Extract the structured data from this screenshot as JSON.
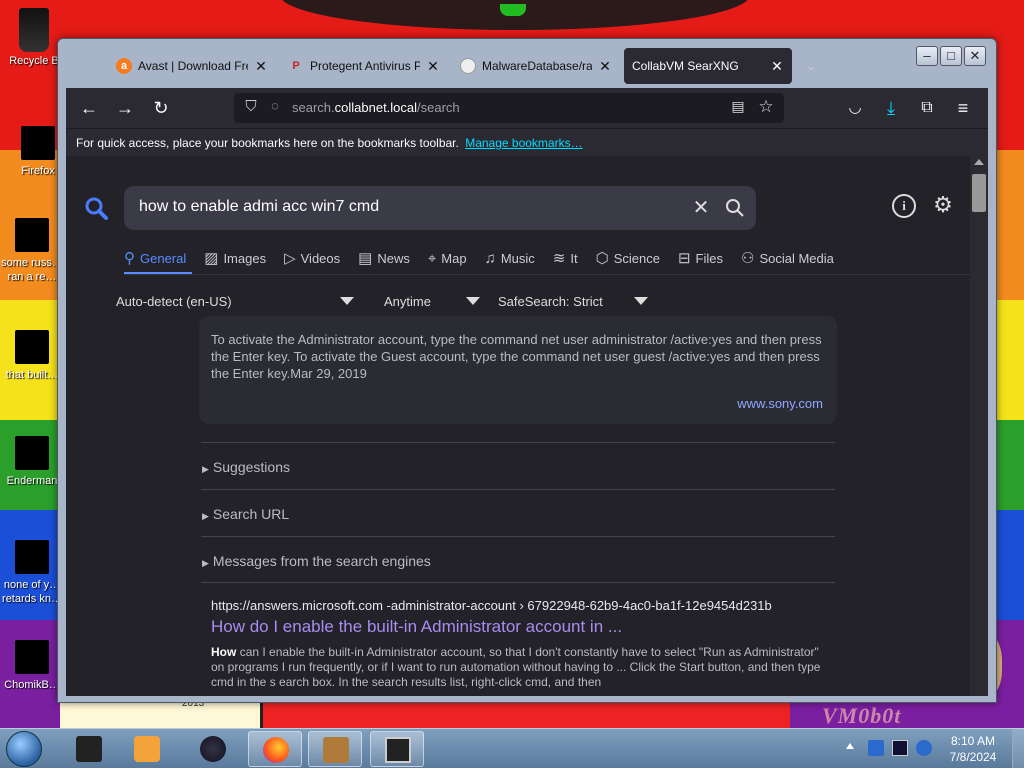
{
  "desktop": {
    "icons": [
      {
        "label": "Recycle B"
      },
      {
        "label": "Firefox"
      },
      {
        "label": "some russ… ran a re…"
      },
      {
        "label": "that built…"
      },
      {
        "label": "Enderman"
      },
      {
        "label": "none of y… retards kn…"
      },
      {
        "label": "ChomikB…"
      }
    ],
    "year_text": "2013",
    "corner_text": "VM0b0t"
  },
  "browser": {
    "tabs": [
      {
        "title": "Avast | Download Fre",
        "icon": "avast-icon",
        "icon_color": "#f47b20"
      },
      {
        "title": "Protegent Antivirus P",
        "icon": "protegent-icon",
        "icon_color": "#c22"
      },
      {
        "title": "MalwareDatabase/ran",
        "icon": "github-icon",
        "icon_color": "#ddd"
      },
      {
        "title": "CollabVM SearXNG",
        "icon": "",
        "icon_color": ""
      }
    ],
    "url_prefix": "search.",
    "url_host": "collabnet.local",
    "url_path": "/search",
    "bookmarks_hint": "For quick access, place your bookmarks here on the bookmarks toolbar.",
    "bookmarks_link": "Manage bookmarks…"
  },
  "search": {
    "query": "how to enable admi acc win7 cmd",
    "categories": [
      {
        "label": "General",
        "icon": "search-icon"
      },
      {
        "label": "Images",
        "icon": "image-icon"
      },
      {
        "label": "Videos",
        "icon": "play-icon"
      },
      {
        "label": "News",
        "icon": "newspaper-icon"
      },
      {
        "label": "Map",
        "icon": "map-pin-icon"
      },
      {
        "label": "Music",
        "icon": "music-icon"
      },
      {
        "label": "It",
        "icon": "layers-icon"
      },
      {
        "label": "Science",
        "icon": "cube-icon"
      },
      {
        "label": "Files",
        "icon": "files-icon"
      },
      {
        "label": "Social Media",
        "icon": "people-icon"
      }
    ],
    "filters": {
      "language": "Auto-detect (en-US)",
      "time": "Anytime",
      "safesearch": "SafeSearch: Strict"
    },
    "answer": {
      "text": "To activate the Administrator account, type the command net user administrator /active:yes and then press the Enter key. To activate the Guest account, type the command net user guest /active:yes and then press the Enter key.Mar 29, 2019",
      "source": "www.sony.com"
    },
    "sections": [
      "Suggestions",
      "Search URL",
      "Messages from the search engines"
    ],
    "result": {
      "url": "https://answers.microsoft.com  -administrator-account › 67922948-62b9-4ac0-ba1f-12e9454d231b",
      "title": "How do I enable the built-in Administrator account in ...",
      "snippet": "can I enable the built-in Administrator account, so that I don't constantly have to select \"Run as Administrator\" on programs I run frequently, or if I want to run automation without having to ... Click the Start button, and then type cmd in the s earch box. In the search results list, right-click cmd, and then"
    }
  },
  "taskbar": {
    "time": "8:10 AM",
    "date": "7/8/2024"
  }
}
